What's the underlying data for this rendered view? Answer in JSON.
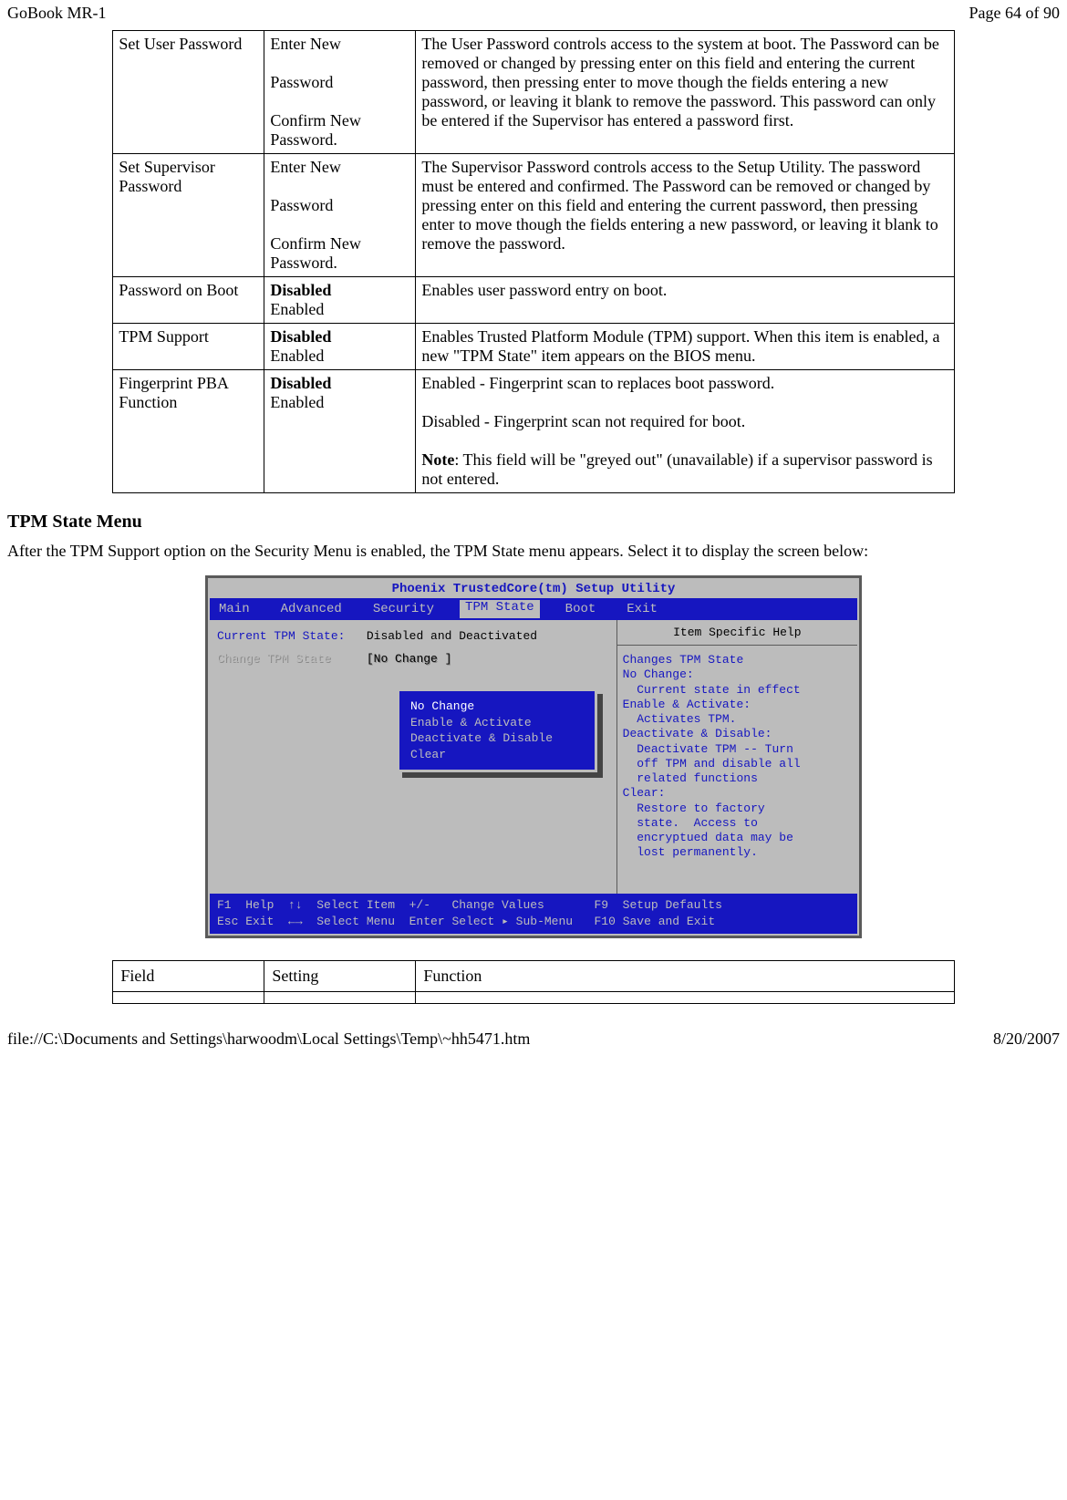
{
  "header": {
    "left": "GoBook MR-1",
    "right": "Page 64 of 90"
  },
  "table1": {
    "rows": [
      {
        "field": "Set User Password",
        "setting_lines": [
          "Enter New",
          "",
          "Password",
          "",
          "Confirm New Password."
        ],
        "function": "The User Password controls access to the system at boot. The Password can be removed or changed  by pressing enter on this field and entering the current password, then pressing enter to move though the fields entering a new password, or leaving it blank to remove the password.  This password can only be entered if the Supervisor has entered a password first."
      },
      {
        "field": "Set Supervisor Password",
        "setting_lines": [
          "Enter New",
          "",
          "Password",
          "",
          "Confirm New Password."
        ],
        "function": "The Supervisor Password controls access to the Setup Utility.  The password must be entered and confirmed.  The Password can be removed or changed  by pressing enter on this field and entering the current password, then pressing enter to move though the fields entering a new password, or leaving it blank to remove the password."
      },
      {
        "field": "Password on Boot",
        "setting_bold": "Disabled",
        "setting_plain": "Enabled",
        "function": "Enables user  password entry on boot."
      },
      {
        "field": "TPM Support",
        "setting_bold": "Disabled",
        "setting_plain": "Enabled",
        "function": "Enables Trusted Platform Module (TPM) support.  When this item is enabled, a new \"TPM State\" item appears on the BIOS menu."
      },
      {
        "field": "Fingerprint PBA Function",
        "setting_bold": "Disabled",
        "setting_plain": "Enabled",
        "function_lines": [
          "Enabled - Fingerprint scan to replaces boot password.",
          "",
          "Disabled - Fingerprint scan not required for boot.",
          ""
        ],
        "function_note_bold": "Note",
        "function_note_rest": ": This field will be \"greyed out\" (unavailable) if a supervisor password is not entered."
      }
    ]
  },
  "section_title": "TPM State Menu",
  "body_para": "After the TPM Support option on the Security Menu is enabled, the TPM State menu appears.  Select it to display the screen below:",
  "bios": {
    "title": "Phoenix TrustedCore(tm) Setup Utility",
    "menu": [
      "Main",
      "Advanced",
      "Security",
      "TPM State",
      "Boot",
      "Exit"
    ],
    "active_menu_index": 3,
    "left": {
      "label1": "Current TPM State:",
      "value1": "Disabled and Deactivated",
      "label2": "Change TPM State",
      "value2": "[No Change   ]"
    },
    "popup": [
      "No Change",
      "Enable & Activate",
      "Deactivate & Disable",
      "Clear"
    ],
    "right_title": "Item Specific Help",
    "right_lines": [
      "Changes TPM State",
      "No Change:",
      "  Current state in effect",
      "Enable & Activate:",
      "  Activates TPM.",
      "Deactivate & Disable:",
      "  Deactivate TPM -- Turn",
      "  off TPM and disable all",
      "  related functions",
      "Clear:",
      "  Restore to factory",
      "  state.  Access to",
      "  encryptued data may be",
      "  lost permanently."
    ],
    "footer_l1": "F1  Help  ↑↓  Select Item  +/-   Change Values       F9  Setup Defaults",
    "footer_l2": "Esc Exit  ←→  Select Menu  Enter Select ▸ Sub-Menu   F10 Save and Exit"
  },
  "table2_headers": {
    "c1": "Field",
    "c2": "Setting",
    "c3": "Function"
  },
  "footer": {
    "left": "file://C:\\Documents and Settings\\harwoodm\\Local Settings\\Temp\\~hh5471.htm",
    "right": "8/20/2007"
  }
}
